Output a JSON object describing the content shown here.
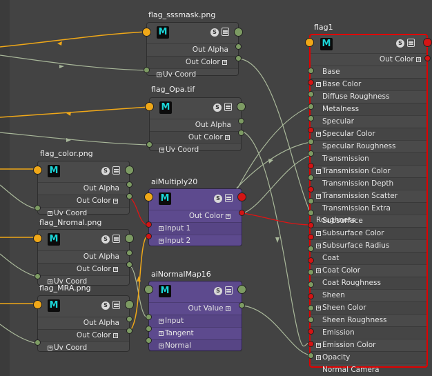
{
  "nodes": {
    "sssmask": {
      "title": "flag_sssmask.png",
      "badge": "M",
      "rows": [
        "Out Alpha",
        "Out Color",
        "Uv Coord"
      ]
    },
    "opa": {
      "title": "flag_Opa.tif",
      "badge": "M",
      "rows": [
        "Out Alpha",
        "Out Color",
        "Uv Coord"
      ]
    },
    "color": {
      "title": "flag_color.png",
      "badge": "M",
      "rows": [
        "Out Alpha",
        "Out Color",
        "Uv Coord"
      ]
    },
    "nromal": {
      "title": "flag_Nromal.png",
      "badge": "M",
      "rows": [
        "Out Alpha",
        "Out Color",
        "Uv Coord"
      ]
    },
    "mra": {
      "title": "flag_MRA.png",
      "badge": "M",
      "rows": [
        "Out Alpha",
        "Out Color",
        "Uv Coord"
      ]
    },
    "multiply": {
      "title": "aiMultiply20",
      "badge": "M",
      "rows": [
        "Out Color",
        "Input 1",
        "Input 2"
      ]
    },
    "normalmap": {
      "title": "aiNormalMap16",
      "badge": "M",
      "rows": [
        "Out Value",
        "Input",
        "Tangent",
        "Normal"
      ]
    },
    "flag1": {
      "title": "flag1",
      "badge": "M",
      "out": "Out Color",
      "attrs": [
        "Base",
        "Base Color",
        "Diffuse Roughness",
        "Metalness",
        "Specular",
        "Specular Color",
        "Specular Roughness",
        "Transmission",
        "Transmission Color",
        "Transmission Depth",
        "Transmission Scatter",
        "Transmission Extra Roughness",
        "Subsurface",
        "Subsurface Color",
        "Subsurface Radius",
        "Coat",
        "Coat Color",
        "Coat Roughness",
        "Sheen",
        "Sheen Color",
        "Sheen Roughness",
        "Emission",
        "Emission Color",
        "Opacity",
        "Normal Camera"
      ]
    }
  },
  "icons": {
    "s": "S",
    "expand": "+"
  },
  "colors": {
    "wire_gray": "#a9b89a",
    "wire_yellow": "#f0a818",
    "wire_red": "#e01414",
    "purple_node": "#5d4a8e",
    "port_green": "#7d9b63",
    "port_red": "#d41414",
    "selected_border": "#e00000"
  }
}
